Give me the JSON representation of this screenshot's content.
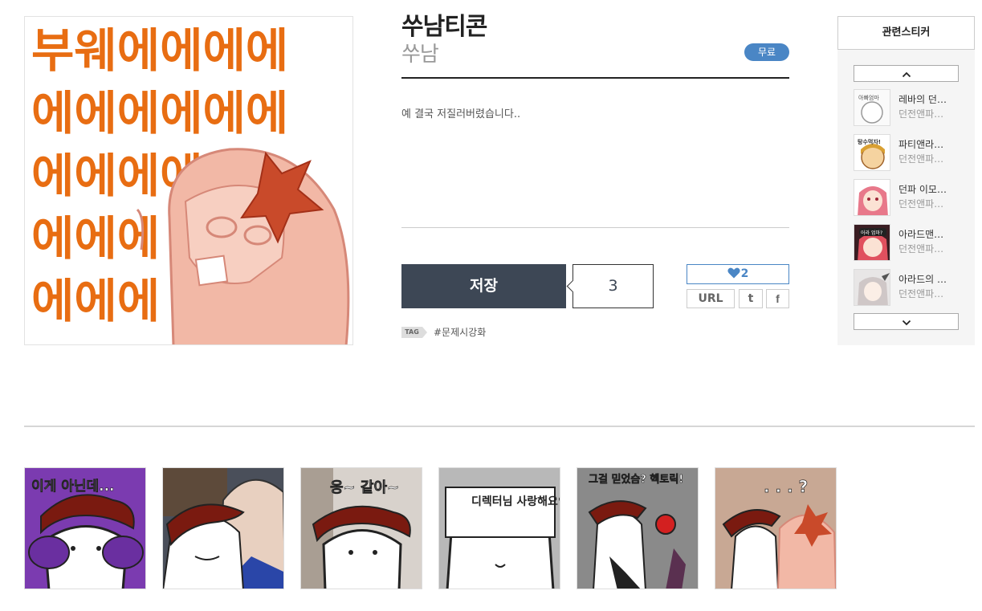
{
  "sticker": {
    "title": "쑤남티콘",
    "author": "쑤남",
    "price_badge": "무료",
    "description": "예 결국 저질러버렸습니다..",
    "save_label": "저장",
    "save_count": "3",
    "like_count": "2",
    "share": {
      "url_label": "URL",
      "twitter_label": "t",
      "facebook_label": "f"
    },
    "tag_label": "TAG",
    "tags": [
      "#문제시강화"
    ],
    "preview_text_rows": [
      "부웨에에에에",
      "에에에에에에",
      "에에에에에",
      "에에에",
      "에에에"
    ]
  },
  "related": {
    "heading": "관련스티커",
    "items": [
      {
        "title": "레바의 던…",
        "author": "던전앤파…"
      },
      {
        "title": "파티앤라…",
        "author": "던전앤파…"
      },
      {
        "title": "던파 이모…",
        "author": "던전앤파…"
      },
      {
        "title": "아라드맨…",
        "author": "던전앤파…"
      },
      {
        "title": "아라드의 …",
        "author": "던전앤파…"
      }
    ],
    "thumb_texts": [
      "아빠엄마",
      "탕수먹자!",
      "",
      "어라 엄마?",
      ""
    ]
  },
  "gallery": {
    "captions": [
      "이게 아닌데...",
      "",
      "응~ 같아~",
      "디렉터님 사랑해요♥",
      "그걸 믿었슴? 헥토릭!",
      ". . . ?"
    ]
  },
  "colors": {
    "accent_blue": "#4a86c5",
    "save_button_bg": "#3d4755",
    "preview_text_orange": "#e86d12"
  }
}
